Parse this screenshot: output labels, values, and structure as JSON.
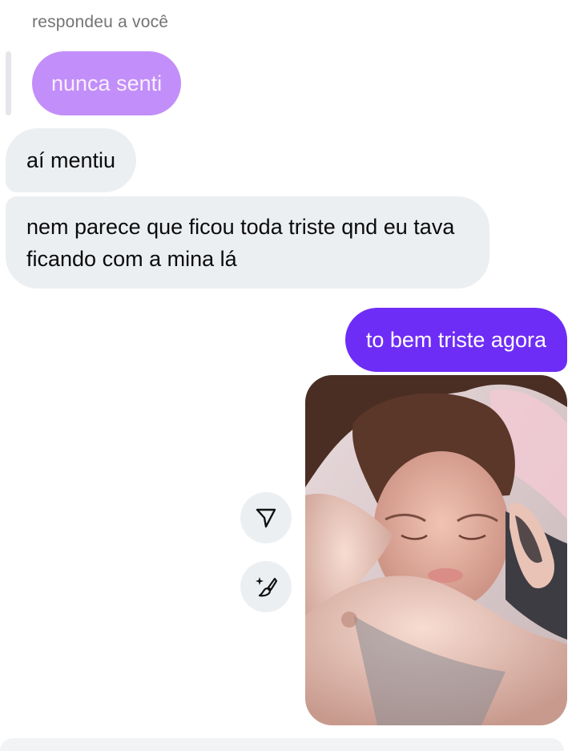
{
  "thread": {
    "reply_context": "respondeu a você",
    "quoted_message": "nunca senti",
    "messages": [
      {
        "direction": "incoming",
        "text": "aí mentiu"
      },
      {
        "direction": "incoming",
        "text": "nem parece que ficou toda triste qnd eu tava ficando com a mina lá"
      },
      {
        "direction": "outgoing",
        "text": "to bem triste agora"
      }
    ],
    "photo": {
      "description_icon": "photo-attachment"
    }
  },
  "actions": {
    "share_icon": "share-arrow-icon",
    "edit_icon": "magic-brush-icon"
  },
  "colors": {
    "incoming_bubble": "#eceff2",
    "outgoing_bubble": "#6e2df6",
    "quoted_bubble": "#c28ef9",
    "meta_text": "#737373"
  }
}
